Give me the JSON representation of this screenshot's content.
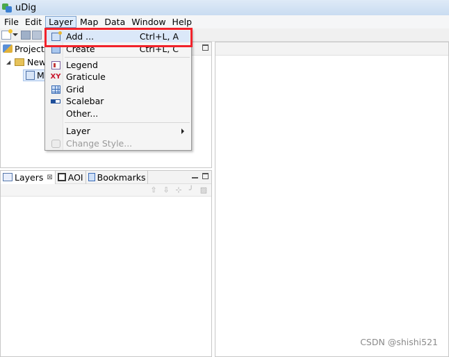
{
  "window": {
    "title": "uDig"
  },
  "menubar": [
    "File",
    "Edit",
    "Layer",
    "Map",
    "Data",
    "Window",
    "Help"
  ],
  "projects_panel": {
    "tab_label": "Projects",
    "tree": {
      "project_label": "New",
      "map_label": "M"
    }
  },
  "layers_panel": {
    "tabs": [
      {
        "label": "Layers",
        "icon": "layers-icon",
        "close": "⊠"
      },
      {
        "label": "AOI",
        "icon": "aoi-icon"
      },
      {
        "label": "Bookmarks",
        "icon": "bookmarks-icon"
      }
    ],
    "toolbar_icons": [
      "move-up-icon",
      "move-down-icon",
      "connect-icon",
      "pen-icon",
      "style-icon"
    ]
  },
  "layer_menu": {
    "items": [
      {
        "label": "Add ...",
        "accelerator": "Ctrl+L, A",
        "icon": "add-layer-icon",
        "highlighted": true
      },
      {
        "label": "Create",
        "accelerator": "Ctrl+L, C",
        "icon": "create-layer-icon"
      },
      {
        "label": "Legend",
        "icon": "legend-icon"
      },
      {
        "label": "Graticule",
        "icon": "graticule-icon",
        "glyph": "XY"
      },
      {
        "label": "Grid",
        "icon": "grid-icon"
      },
      {
        "label": "Scalebar",
        "icon": "scalebar-icon"
      },
      {
        "label": "Other...",
        "icon": ""
      },
      {
        "label": "Layer",
        "submenu": true
      },
      {
        "label": "Change Style...",
        "icon": "change-style-icon",
        "disabled": true
      }
    ]
  },
  "watermark": "CSDN @shishi521",
  "colors": {
    "highlight_box": "#f2222a",
    "menu_selected": "#dcebfc"
  }
}
